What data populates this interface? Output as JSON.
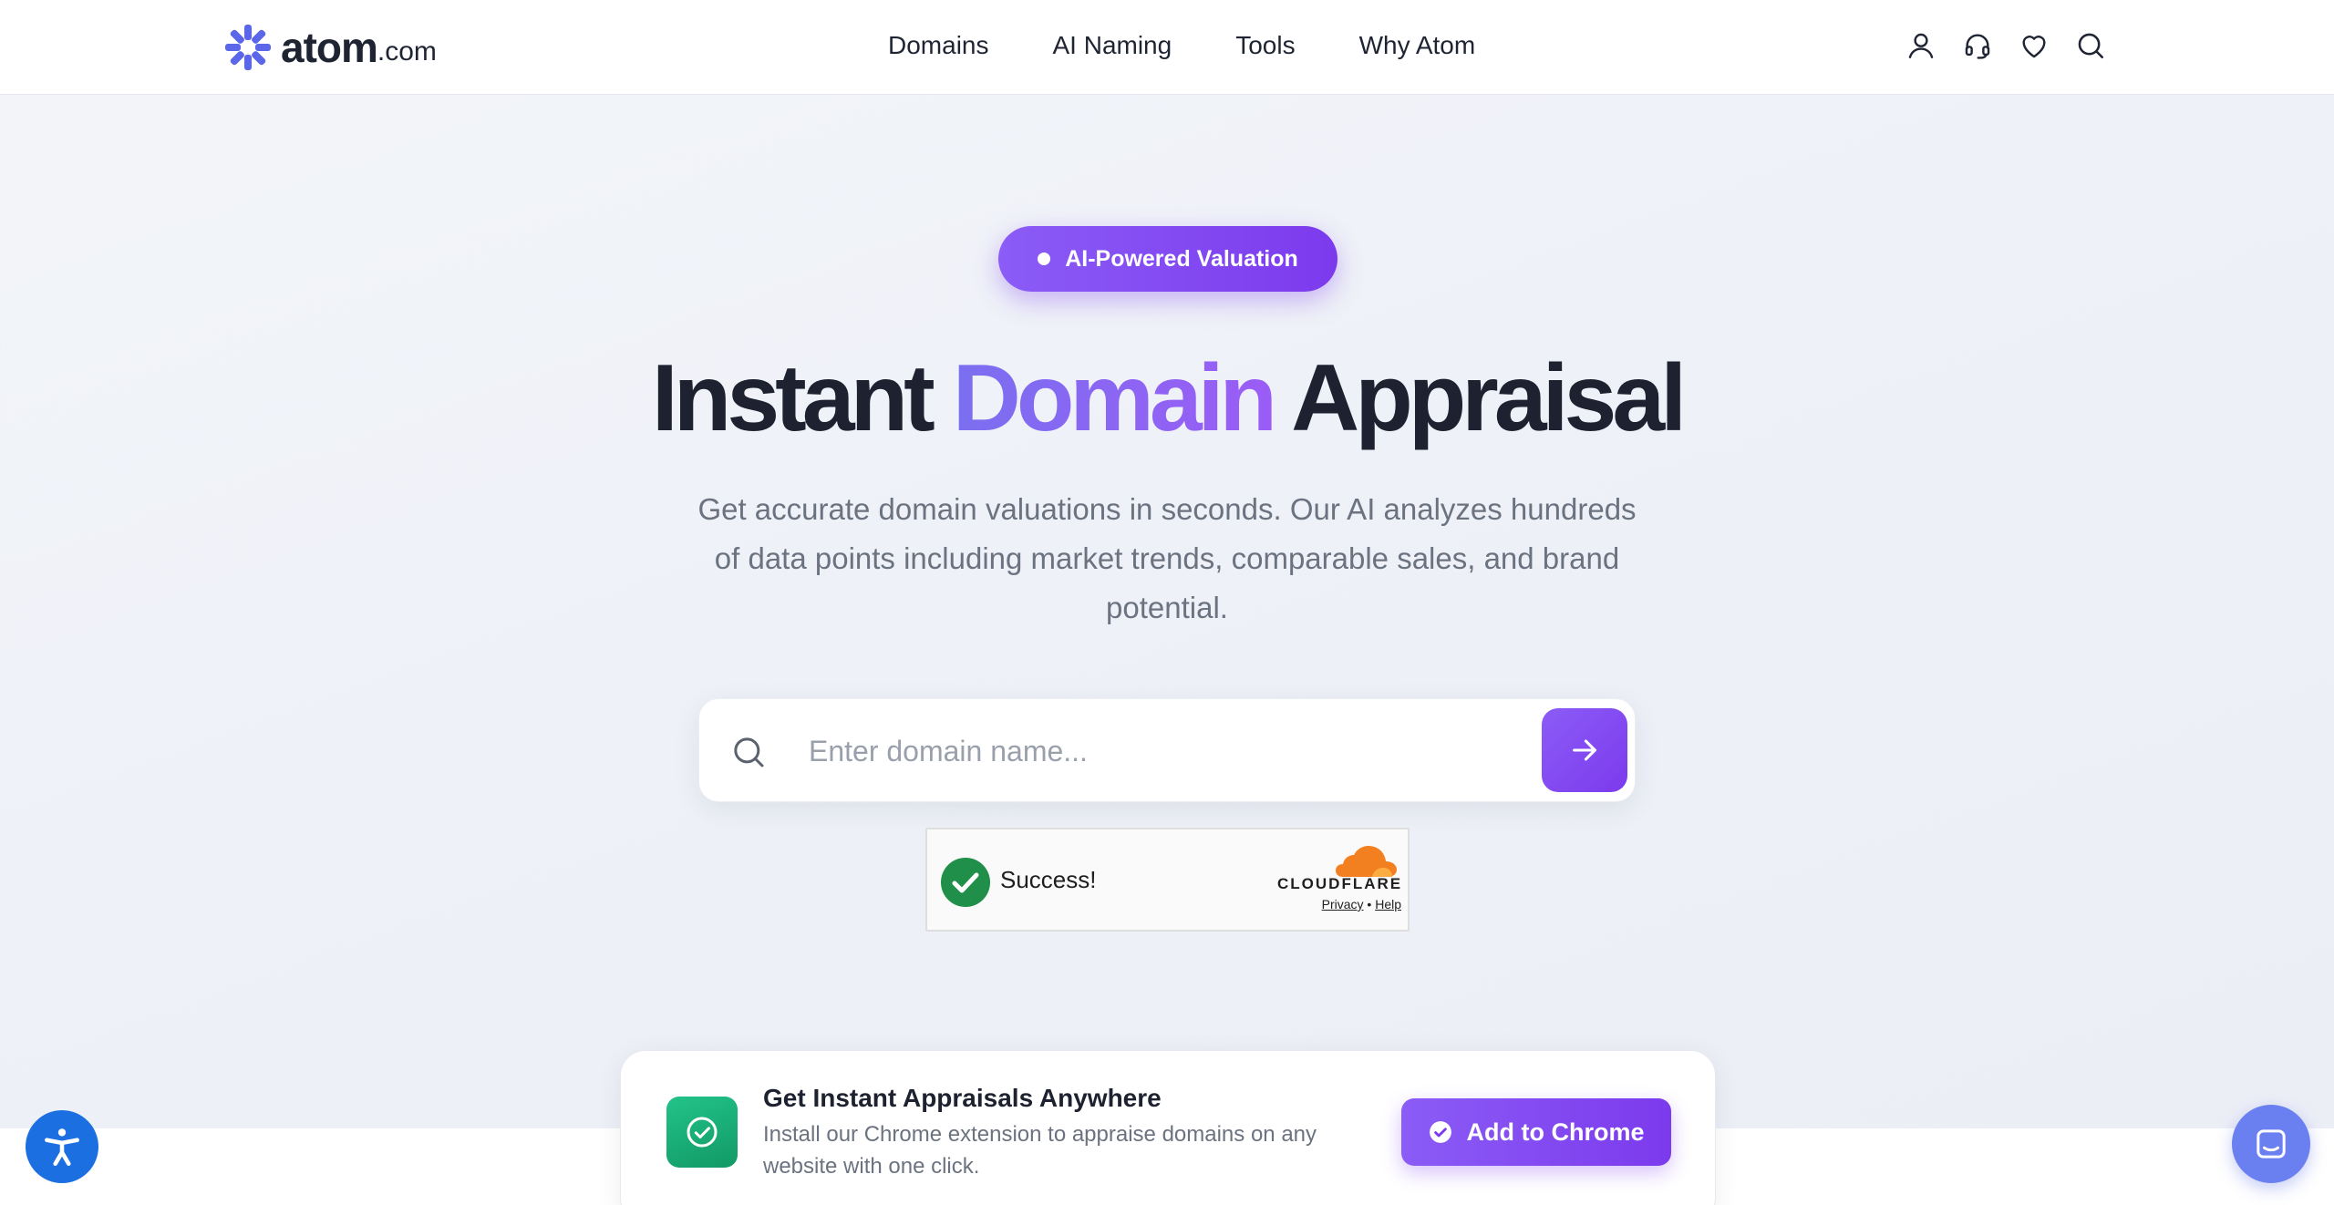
{
  "header": {
    "logo": {
      "name": "atom",
      "tld": ".com",
      "icon": "atom-star-logo-icon"
    },
    "nav": [
      {
        "label": "Domains"
      },
      {
        "label": "AI Naming"
      },
      {
        "label": "Tools"
      },
      {
        "label": "Why Atom"
      }
    ],
    "icons": [
      "user-icon",
      "headset-icon",
      "heart-icon",
      "search-icon"
    ]
  },
  "hero": {
    "badge": "AI-Powered Valuation",
    "title": {
      "part1": "Instant",
      "accent": "Domain",
      "part2": "Appraisal"
    },
    "subtitle": "Get accurate domain valuations in seconds. Our AI analyzes hundreds of data points including market trends, comparable sales, and brand potential."
  },
  "search": {
    "value": "",
    "placeholder": "Enter domain name..."
  },
  "captcha": {
    "status": "Success!",
    "provider": "CLOUDFLARE",
    "privacy": "Privacy",
    "separator": "•",
    "help": "Help"
  },
  "banner": {
    "title": "Get Instant Appraisals Anywhere",
    "description": "Install our Chrome extension to appraise domains on any website with one click.",
    "button": "Add to Chrome"
  },
  "colors": {
    "accent": "#7c3aed",
    "accent_light": "#8b5cf6",
    "success_green": "#1f8f4a",
    "extension_green": "#129966",
    "cloudflare_orange": "#f38020",
    "accessibility_blue": "#1b6fe0",
    "chat_blue": "#6a7ff0"
  }
}
